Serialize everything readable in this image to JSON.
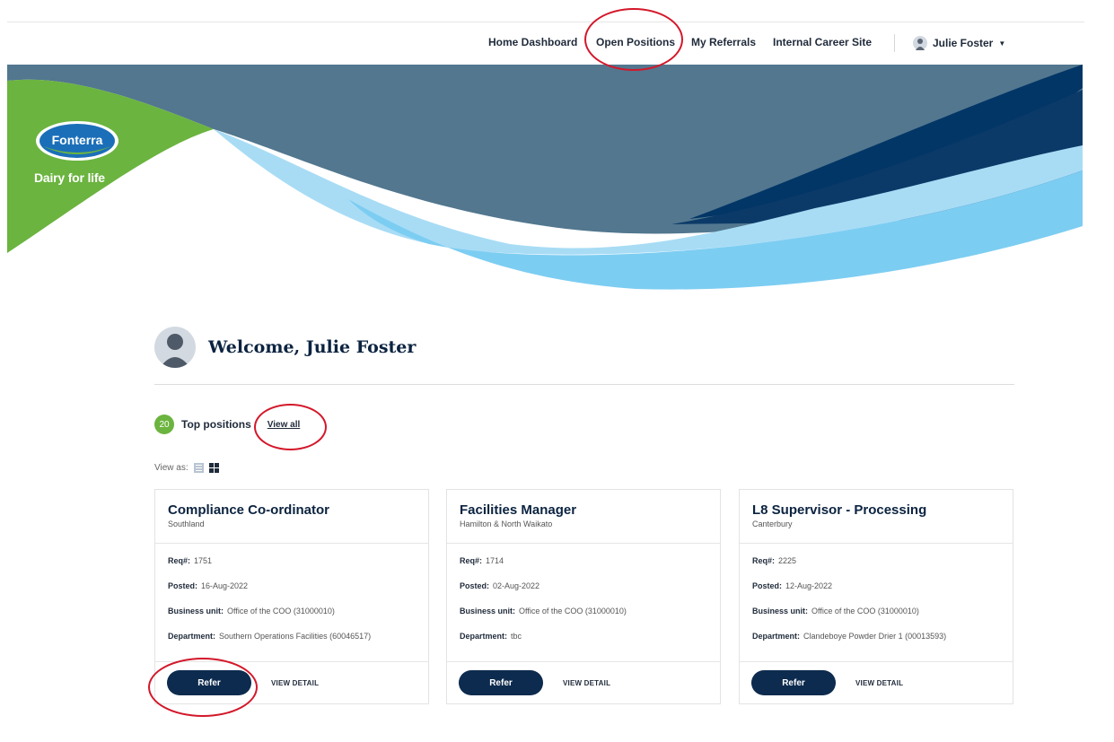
{
  "nav": {
    "items": [
      "Home Dashboard",
      "Open Positions",
      "My Referrals",
      "Internal Career Site"
    ],
    "user_name": "Julie Foster"
  },
  "brand": {
    "logo_text": "Fonterra",
    "tagline": "Dairy for life",
    "green": "#6bb43f",
    "navy": "#0d2b4e"
  },
  "welcome": {
    "title": "Welcome, Julie Foster"
  },
  "top_positions": {
    "count": "20",
    "label": "Top positions",
    "view_all": "View all"
  },
  "view_as": {
    "label": "View as:"
  },
  "field_labels": {
    "req": "Req#:",
    "posted": "Posted:",
    "business_unit": "Business unit:",
    "department": "Department:"
  },
  "cards": [
    {
      "title": "Compliance Co-ordinator",
      "location": "Southland",
      "req": "1751",
      "posted": "16-Aug-2022",
      "business_unit": "Office of the COO (31000010)",
      "department": "Southern Operations Facilities (60046517)",
      "refer": "Refer",
      "view_detail": "VIEW DETAIL"
    },
    {
      "title": "Facilities Manager",
      "location": "Hamilton & North Waikato",
      "req": "1714",
      "posted": "02-Aug-2022",
      "business_unit": "Office of the COO (31000010)",
      "department": "tbc",
      "refer": "Refer",
      "view_detail": "VIEW DETAIL"
    },
    {
      "title": "L8 Supervisor - Processing",
      "location": "Canterbury",
      "req": "2225",
      "posted": "12-Aug-2022",
      "business_unit": "Office of the COO (31000010)",
      "department": "Clandeboye Powder Drier 1 (00013593)",
      "refer": "Refer",
      "view_detail": "VIEW DETAIL"
    }
  ],
  "icons": {
    "avatar": "user-silhouette-icon",
    "list_view": "list-view-icon",
    "grid_view": "grid-view-icon",
    "caret": "chevron-down-icon"
  },
  "annotation_color": "#d3182a"
}
